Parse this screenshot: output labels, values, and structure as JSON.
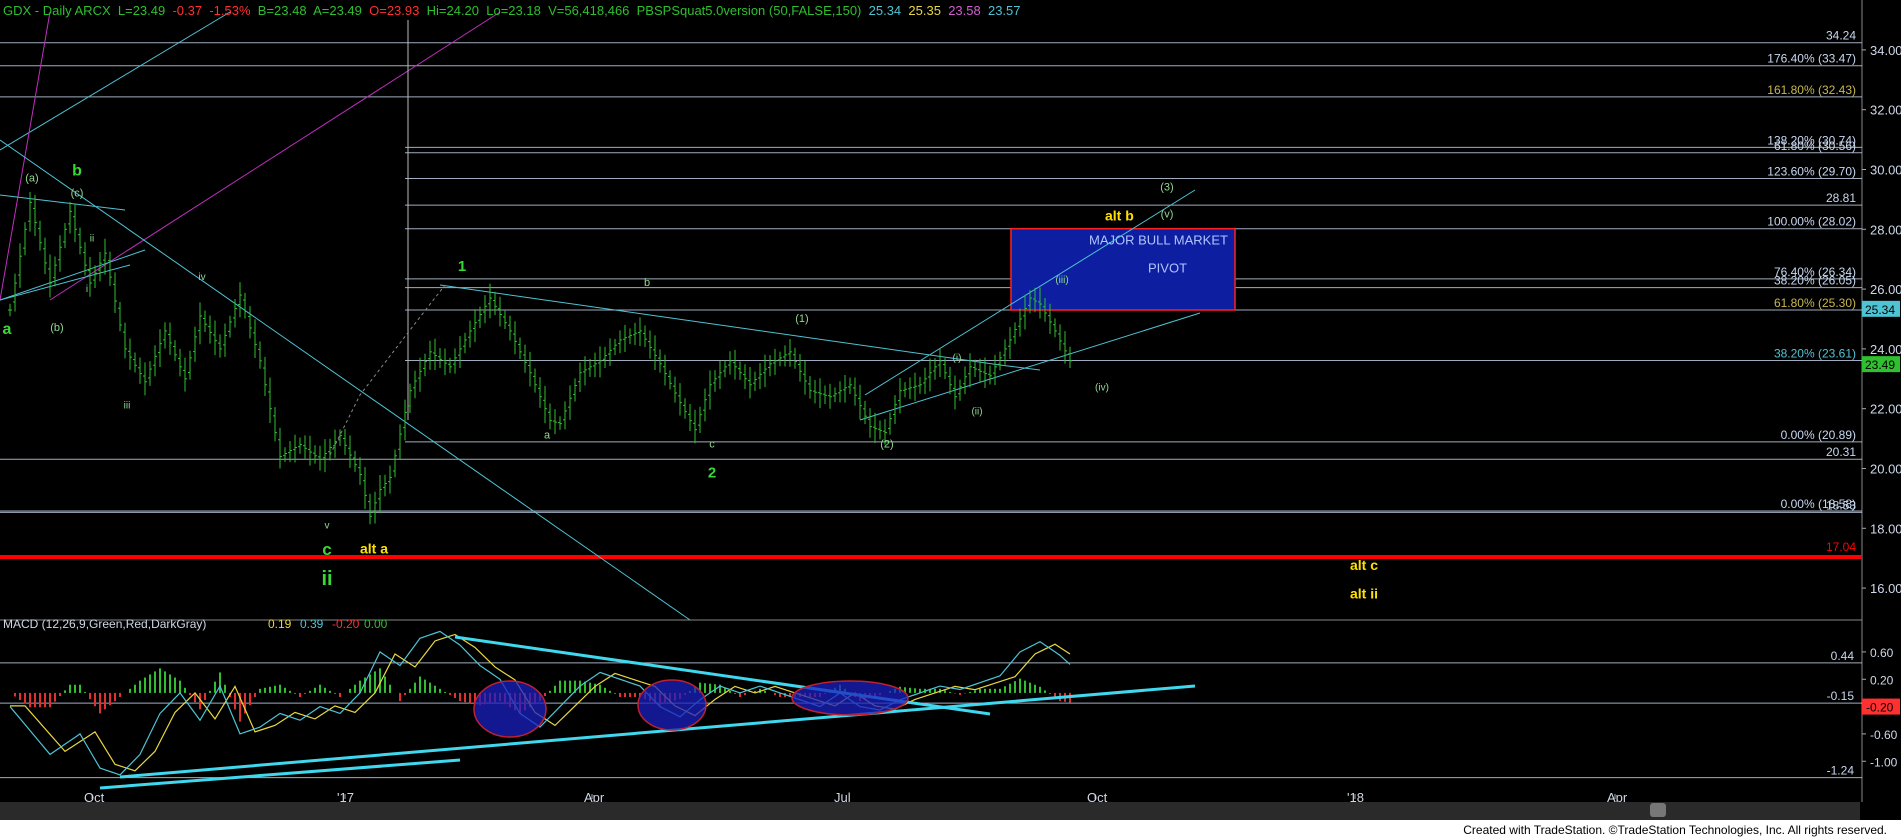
{
  "header": {
    "symbol": "GDX - Daily  ARCX",
    "last": "L=23.49",
    "change": "-0.37",
    "pct": "-1.53%",
    "bid": "B=23.48",
    "ask": "A=23.49",
    "open": "O=23.93",
    "high": "Hi=24.20",
    "low": "Lo=23.18",
    "volume": "V=56,418,466",
    "indicator": "PBSPSquat5.0version (50,FALSE,150)",
    "ind_vals": [
      "25.34",
      "25.35",
      "23.58",
      "23.57"
    ]
  },
  "colors": {
    "background": "#000000",
    "bars": "#2fbf2f",
    "trendline": "#4fc3d4",
    "fib": "#c8d8f0",
    "support": "#ff0000",
    "wave_green": "#39d839",
    "wave_yellow": "#ffe000",
    "macd_line": "#4fc3d4",
    "signal_line": "#e8d840",
    "box_fill": "#0d1ea0",
    "box_border": "#ff2020"
  },
  "chart_data": {
    "type": "candlestick",
    "title": "GDX - Daily ARCX",
    "ylim": [
      15.2,
      35.0
    ],
    "y_ticks": [
      "34.00",
      "32.00",
      "30.00",
      "28.00",
      "26.00",
      "24.00",
      "22.00",
      "20.00",
      "18.00",
      "16.00"
    ],
    "x_ticks": [
      "Oct",
      "'17",
      "Apr",
      "Jul",
      "Oct",
      "'18",
      "Apr"
    ],
    "last_price": "23.49",
    "price_path": [
      [
        0,
        25.3
      ],
      [
        4,
        28.9
      ],
      [
        8,
        26.2
      ],
      [
        12,
        28.6
      ],
      [
        16,
        26.2
      ],
      [
        19,
        27.2
      ],
      [
        23,
        24.0
      ],
      [
        27,
        22.9
      ],
      [
        31,
        24.6
      ],
      [
        35,
        23.0
      ],
      [
        38,
        25.1
      ],
      [
        42,
        24.0
      ],
      [
        46,
        25.8
      ],
      [
        50,
        23.6
      ],
      [
        54,
        20.4
      ],
      [
        58,
        20.8
      ],
      [
        62,
        20.3
      ],
      [
        66,
        21.1
      ],
      [
        70,
        19.8
      ],
      [
        72,
        18.4
      ],
      [
        74,
        19.3
      ],
      [
        76,
        19.7
      ],
      [
        80,
        22.6
      ],
      [
        84,
        23.9
      ],
      [
        88,
        23.4
      ],
      [
        92,
        24.6
      ],
      [
        96,
        25.7
      ],
      [
        100,
        24.6
      ],
      [
        104,
        23.2
      ],
      [
        108,
        21.6
      ],
      [
        110,
        21.5
      ],
      [
        114,
        23.2
      ],
      [
        118,
        23.6
      ],
      [
        122,
        24.3
      ],
      [
        126,
        24.6
      ],
      [
        130,
        23.5
      ],
      [
        134,
        22.2
      ],
      [
        137,
        21.3
      ],
      [
        140,
        22.8
      ],
      [
        144,
        23.6
      ],
      [
        148,
        22.8
      ],
      [
        152,
        23.5
      ],
      [
        156,
        23.9
      ],
      [
        160,
        22.6
      ],
      [
        164,
        22.4
      ],
      [
        168,
        22.8
      ],
      [
        172,
        21.4
      ],
      [
        175,
        21.2
      ],
      [
        178,
        22.6
      ],
      [
        182,
        22.8
      ],
      [
        186,
        23.6
      ],
      [
        189,
        22.4
      ],
      [
        192,
        23.4
      ],
      [
        196,
        23.1
      ],
      [
        200,
        24.3
      ],
      [
        204,
        25.7
      ],
      [
        206,
        25.5
      ],
      [
        209,
        24.6
      ],
      [
        212,
        23.6
      ]
    ],
    "fib_levels": [
      {
        "label": "34.24",
        "value": 34.24
      },
      {
        "label": "176.40% (33.47)",
        "value": 33.47
      },
      {
        "label": "161.80% (32.43)",
        "value": 32.43
      },
      {
        "label": "138.20% (30.74)",
        "value": 30.74
      },
      {
        "label": "61.80% (30.56)",
        "value": 30.56
      },
      {
        "label": "123.60% (29.70)",
        "value": 29.7
      },
      {
        "label": "28.81",
        "value": 28.81
      },
      {
        "label": "100.00% (28.02)",
        "value": 28.02
      },
      {
        "label": "76.40% (26.34)",
        "value": 26.34
      },
      {
        "label": "38.20% (26.05)",
        "value": 26.05
      },
      {
        "label": "61.80% (25.30)",
        "value": 25.3
      },
      {
        "label": "38.20% (23.61)",
        "value": 23.61
      },
      {
        "label": "0.00% (20.89)",
        "value": 20.89
      },
      {
        "label": "20.31",
        "value": 20.31
      },
      {
        "label": "0.00% (18.58)",
        "value": 18.58
      },
      {
        "label": "18.53",
        "value": 18.53
      }
    ],
    "support_line": {
      "label": "17.04",
      "value": 17.04
    },
    "right_badges": [
      {
        "label": "25.34",
        "value": 25.34,
        "color": "#4fc3d4"
      },
      {
        "label": "23.49",
        "value": 23.49,
        "color": "#2fbf2f"
      }
    ],
    "box": {
      "text_line1": "MAJOR BULL MARKET",
      "text_line2": "PIVOT",
      "y_top": 28.02,
      "y_bottom": 25.3
    },
    "wave_labels_green": [
      {
        "text": "a",
        "x": -1,
        "y": 24.5,
        "size": 16
      },
      {
        "text": "b",
        "x": 13,
        "y": 29.8,
        "size": 16
      },
      {
        "text": "(a)",
        "x": 4,
        "y": 29.6,
        "size": 11
      },
      {
        "text": "(c)",
        "x": 13,
        "y": 29.1,
        "size": 11
      },
      {
        "text": "ii",
        "x": 16,
        "y": 27.6,
        "size": 10
      },
      {
        "text": "i",
        "x": 15,
        "y": 25.9,
        "size": 10
      },
      {
        "text": "(b)",
        "x": 9,
        "y": 24.6,
        "size": 11
      },
      {
        "text": "iv",
        "x": 38,
        "y": 26.3,
        "size": 10
      },
      {
        "text": "iii",
        "x": 23,
        "y": 22.0,
        "size": 10
      },
      {
        "text": "v",
        "x": 63,
        "y": 18.0,
        "size": 10
      },
      {
        "text": "c",
        "x": 63,
        "y": 17.1,
        "size": 17
      },
      {
        "text": "ii",
        "x": 63,
        "y": 16.1,
        "size": 20
      },
      {
        "text": "1",
        "x": 90,
        "y": 26.6,
        "size": 15
      },
      {
        "text": "a",
        "x": 107,
        "y": 21.0,
        "size": 11
      },
      {
        "text": "b",
        "x": 127,
        "y": 26.1,
        "size": 11
      },
      {
        "text": "c",
        "x": 140,
        "y": 20.7,
        "size": 11
      },
      {
        "text": "2",
        "x": 140,
        "y": 19.7,
        "size": 15
      },
      {
        "text": "(1)",
        "x": 158,
        "y": 24.9,
        "size": 11
      },
      {
        "text": "(2)",
        "x": 175,
        "y": 20.7,
        "size": 11
      },
      {
        "text": "(i)",
        "x": 189,
        "y": 23.6,
        "size": 10
      },
      {
        "text": "(ii)",
        "x": 193,
        "y": 21.8,
        "size": 10
      },
      {
        "text": "(iii)",
        "x": 210,
        "y": 26.2,
        "size": 10
      },
      {
        "text": "(iv)",
        "x": 218,
        "y": 22.6,
        "size": 10
      },
      {
        "text": "(v)",
        "x": 231,
        "y": 28.4,
        "size": 11
      },
      {
        "text": "(3)",
        "x": 231,
        "y": 29.3,
        "size": 11
      }
    ],
    "wave_labels_yellow": [
      {
        "text": "alt a",
        "x": 70,
        "y": 17.15
      },
      {
        "text": "alt b",
        "x": 219,
        "y": 28.3
      },
      {
        "text": "alt c",
        "x": 268,
        "y": 16.6
      },
      {
        "text": "alt ii",
        "x": 268,
        "y": 15.65
      }
    ],
    "macd": {
      "title": "MACD (12,26,9,Green,Red,DarkGray)",
      "values": [
        {
          "label": "0.19",
          "color": "#e8d840"
        },
        {
          "label": "0.39",
          "color": "#4fc3d4"
        },
        {
          "label": "-0.20",
          "color": "#ff3030"
        },
        {
          "label": "0.00",
          "color": "#2fbf2f"
        }
      ],
      "ylim": [
        -1.45,
        0.95
      ],
      "y_ticks": [
        "0.60",
        "0.20",
        "-0.20",
        "-0.60",
        "-1.00"
      ],
      "levels": [
        {
          "label": "0.44",
          "value": 0.44
        },
        {
          "label": "-0.15",
          "value": -0.15
        },
        {
          "label": "-1.24",
          "value": -1.24
        }
      ],
      "last_badge": {
        "label": "-0.20",
        "value": -0.2
      },
      "macd_path": [
        [
          0,
          -0.2
        ],
        [
          8,
          -0.9
        ],
        [
          14,
          -0.6
        ],
        [
          18,
          -1.1
        ],
        [
          22,
          -1.2
        ],
        [
          26,
          -0.9
        ],
        [
          30,
          -0.3
        ],
        [
          34,
          0.0
        ],
        [
          38,
          -0.4
        ],
        [
          42,
          0.1
        ],
        [
          46,
          -0.6
        ],
        [
          50,
          -0.5
        ],
        [
          54,
          -0.3
        ],
        [
          58,
          -0.4
        ],
        [
          62,
          -0.2
        ],
        [
          66,
          -0.3
        ],
        [
          70,
          0.0
        ],
        [
          74,
          0.6
        ],
        [
          78,
          0.4
        ],
        [
          82,
          0.8
        ],
        [
          86,
          0.9
        ],
        [
          90,
          0.7
        ],
        [
          94,
          0.4
        ],
        [
          98,
          0.2
        ],
        [
          102,
          -0.3
        ],
        [
          106,
          -0.5
        ],
        [
          110,
          -0.2
        ],
        [
          114,
          0.1
        ],
        [
          118,
          0.3
        ],
        [
          122,
          0.2
        ],
        [
          126,
          0.1
        ],
        [
          130,
          -0.2
        ],
        [
          134,
          -0.35
        ],
        [
          138,
          -0.1
        ],
        [
          142,
          0.1
        ],
        [
          146,
          0.0
        ],
        [
          150,
          0.1
        ],
        [
          154,
          0.0
        ],
        [
          158,
          -0.1
        ],
        [
          162,
          -0.2
        ],
        [
          166,
          0.0
        ],
        [
          170,
          -0.2
        ],
        [
          174,
          -0.25
        ],
        [
          178,
          -0.1
        ],
        [
          182,
          0.0
        ],
        [
          186,
          0.1
        ],
        [
          190,
          0.05
        ],
        [
          194,
          0.15
        ],
        [
          198,
          0.25
        ],
        [
          202,
          0.6
        ],
        [
          206,
          0.75
        ],
        [
          210,
          0.55
        ],
        [
          213,
          0.35
        ]
      ]
    }
  },
  "footer": "Created with TradeStation. ©TradeStation Technologies, Inc. All rights reserved."
}
